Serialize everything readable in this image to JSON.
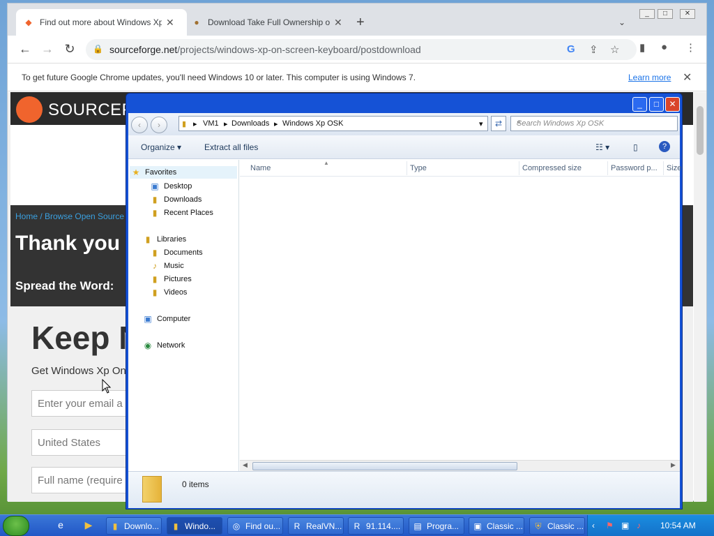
{
  "browser": {
    "tabs": [
      {
        "title": "Find out more about Windows Xp O",
        "icon": "sourceforge-icon",
        "active": true
      },
      {
        "title": "Download Take Full Ownership of Fi",
        "icon": "app-icon",
        "active": false
      }
    ],
    "new_tab": "+",
    "nav": {
      "back": "←",
      "forward": "→",
      "reload": "↻"
    },
    "url_host": "sourceforge.net",
    "url_path": "/projects/windows-xp-on-screen-keyboard/postdownload",
    "infobar": {
      "message": "To get future Google Chrome updates, you'll need Windows 10 or later. This computer is using Windows 7.",
      "learn_more": "Learn more",
      "close": "✕"
    }
  },
  "page": {
    "logo_text": "SOURCEFO",
    "breadcrumb": "Home / Browse Open Source /",
    "thank_you": "Thank you fo",
    "spread": "Spread the Word:",
    "keep": "Keep N",
    "get_text": "Get Windows Xp On",
    "email_placeholder": "Enter your email a",
    "country": "United States",
    "fullname_placeholder": "Full name (require"
  },
  "explorer": {
    "breadcrumb": [
      "VM1",
      "Downloads",
      "Windows Xp OSK"
    ],
    "search_placeholder": "Search Windows Xp OSK",
    "organize": "Organize",
    "extract": "Extract all files",
    "nav": {
      "favorites": "Favorites",
      "desktop": "Desktop",
      "downloads": "Downloads",
      "recent": "Recent Places",
      "libraries": "Libraries",
      "documents": "Documents",
      "music": "Music",
      "pictures": "Pictures",
      "videos": "Videos",
      "computer": "Computer",
      "network": "Network"
    },
    "columns": [
      "Name",
      "Type",
      "Compressed size",
      "Password p...",
      "Size"
    ],
    "status": "0 items"
  },
  "taskbar": {
    "items": [
      {
        "label": "Downlo...",
        "icon": "folder-icon"
      },
      {
        "label": "Windo...",
        "icon": "folder-icon"
      },
      {
        "label": "Find ou...",
        "icon": "chrome-icon"
      },
      {
        "label": "RealVN...",
        "icon": "realvnc-icon"
      },
      {
        "label": "91.114....",
        "icon": "realvnc-icon"
      },
      {
        "label": "Progra...",
        "icon": "programs-icon"
      },
      {
        "label": "Classic ...",
        "icon": "classic-icon"
      },
      {
        "label": "Classic ...",
        "icon": "shield-icon"
      }
    ],
    "clock": "10:54 AM"
  }
}
